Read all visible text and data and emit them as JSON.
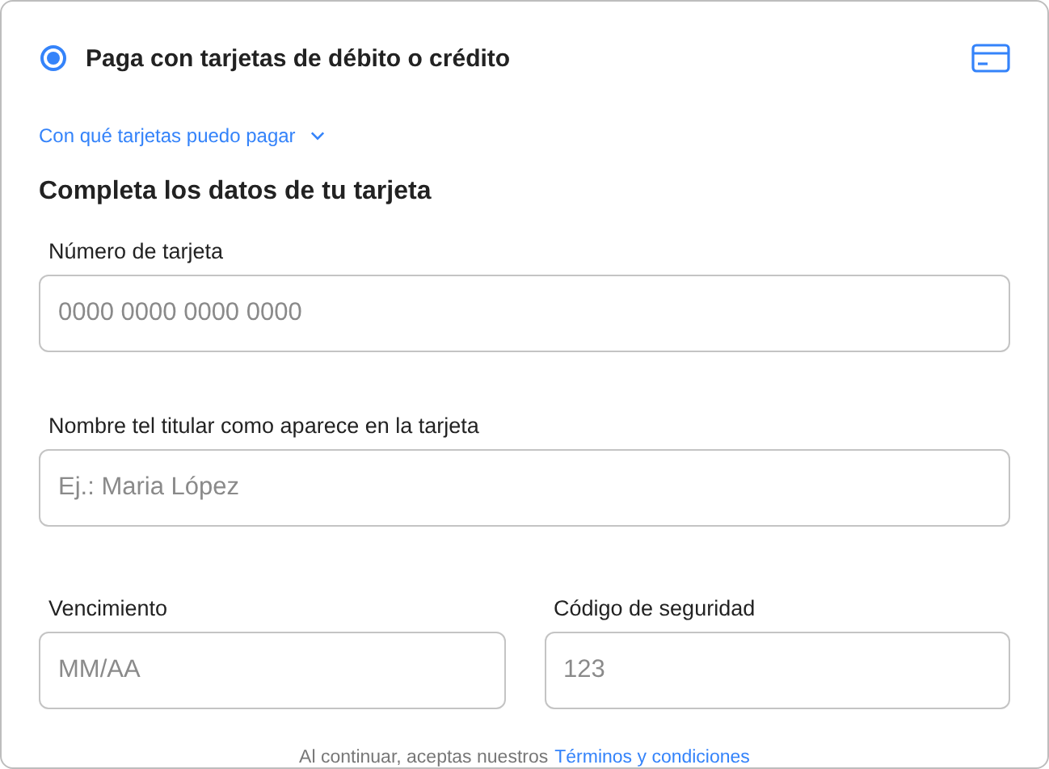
{
  "payment_option": {
    "label": "Paga con tarjetas de débito o crédito",
    "selected": true
  },
  "cards_link": {
    "text": "Con qué tarjetas puedo pagar",
    "expanded": false
  },
  "section_title": "Completa los datos de tu tarjeta",
  "fields": [
    {
      "label": "Número de tarjeta",
      "placeholder": "0000 0000 0000 0000"
    },
    {
      "label": "Nombre tel titular como aparece en la tarjeta",
      "placeholder": "Ej.: Maria López"
    }
  ],
  "split_fields": [
    {
      "label": "Vencimiento",
      "placeholder": "MM/AA"
    },
    {
      "label": "Código de seguridad",
      "placeholder": "123"
    }
  ],
  "footer": {
    "text": "Al continuar, aceptas nuestros",
    "link": "Términos y condiciones"
  }
}
